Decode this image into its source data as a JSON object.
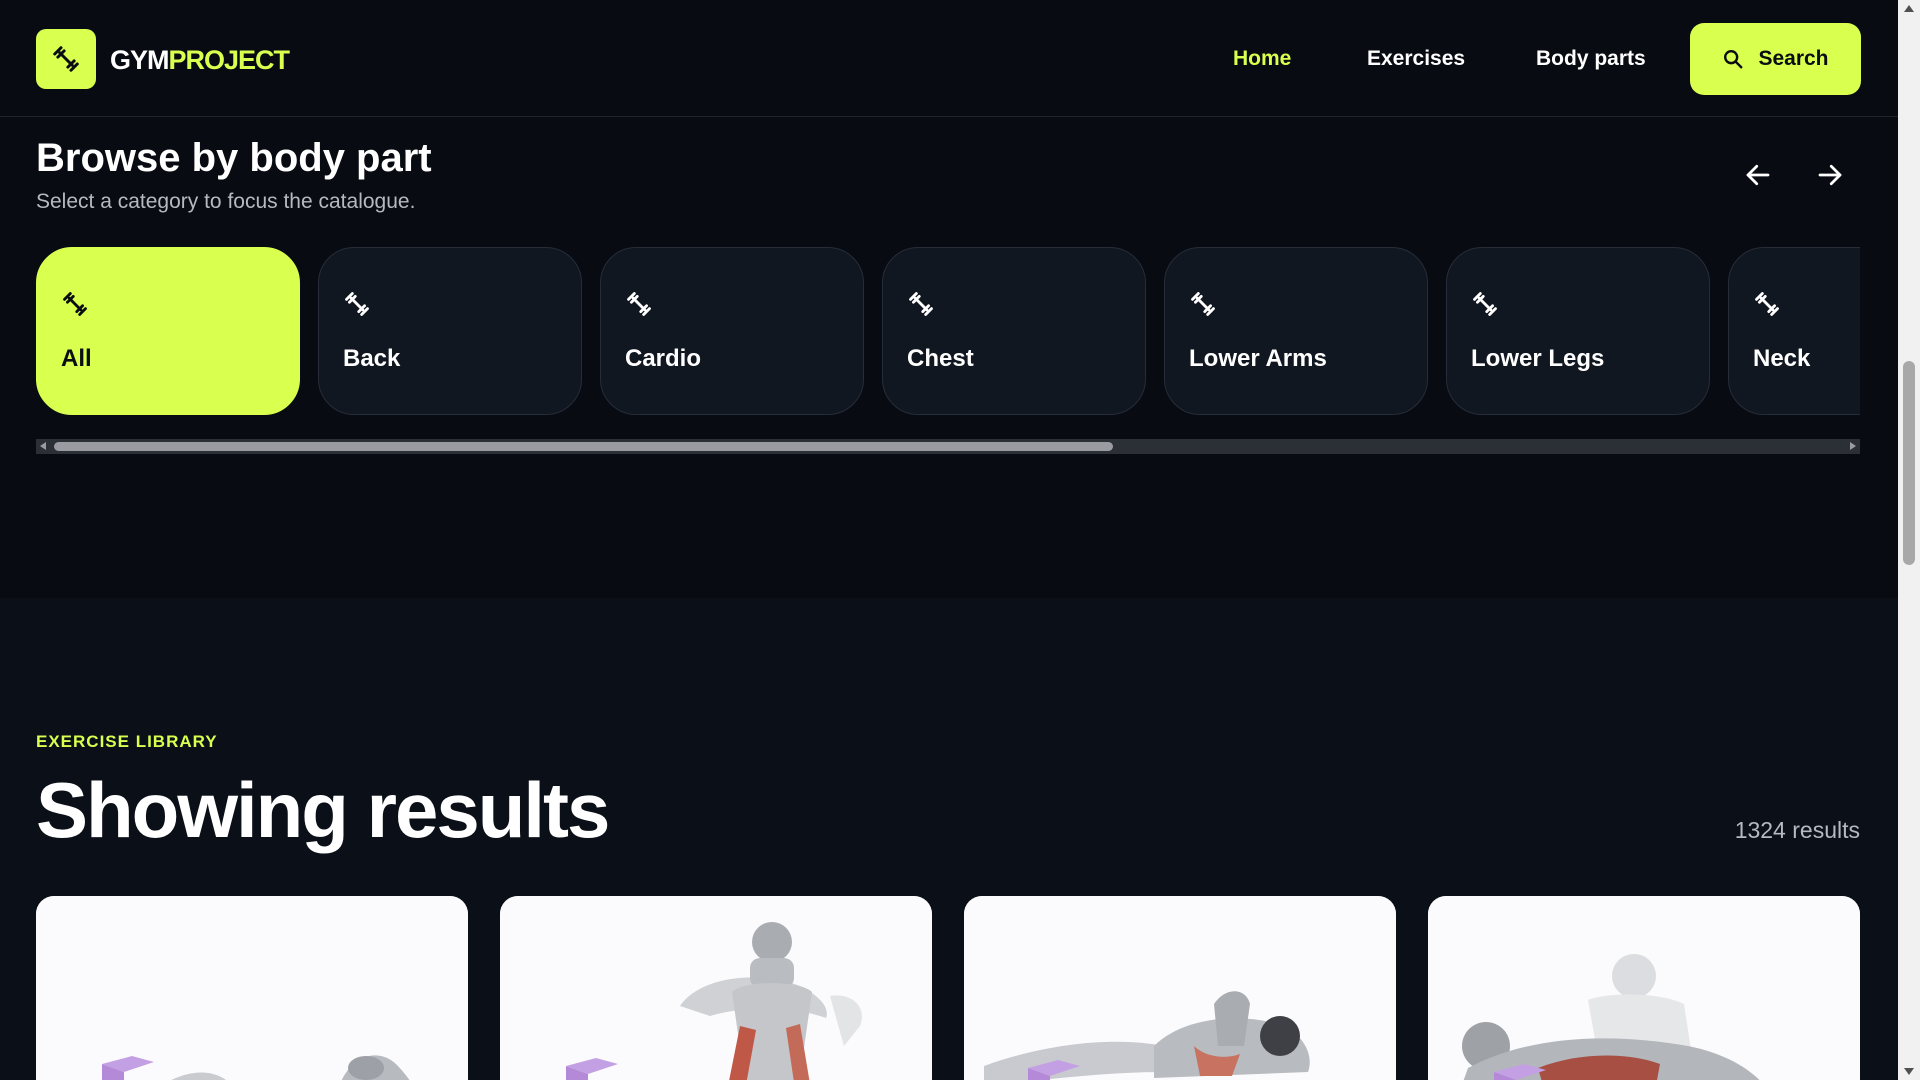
{
  "brand": {
    "part1": "GYM",
    "part2": "PROJECT",
    "logo_icon": "dumbbell-icon",
    "accent": "#d9ff4f",
    "background": "#080b11"
  },
  "nav": {
    "home": "Home",
    "exercises": "Exercises",
    "body_parts": "Body parts",
    "search": "Search",
    "search_icon": "search-icon",
    "active": "Home"
  },
  "browse": {
    "title": "Browse by body part",
    "subtitle": "Select a category to focus the catalogue.",
    "prev_icon": "arrow-left-icon",
    "next_icon": "arrow-right-icon",
    "categories": [
      {
        "label": "All",
        "active": true
      },
      {
        "label": "Back",
        "active": false
      },
      {
        "label": "Cardio",
        "active": false
      },
      {
        "label": "Chest",
        "active": false
      },
      {
        "label": "Lower Arms",
        "active": false
      },
      {
        "label": "Lower Legs",
        "active": false
      },
      {
        "label": "Neck",
        "active": false
      }
    ]
  },
  "library": {
    "eyebrow": "EXERCISE LIBRARY",
    "title": "Showing results",
    "count": "1324 results",
    "cards": [
      {
        "image": "exercise-illustration"
      },
      {
        "image": "exercise-illustration"
      },
      {
        "image": "exercise-illustration"
      },
      {
        "image": "exercise-illustration"
      }
    ]
  }
}
